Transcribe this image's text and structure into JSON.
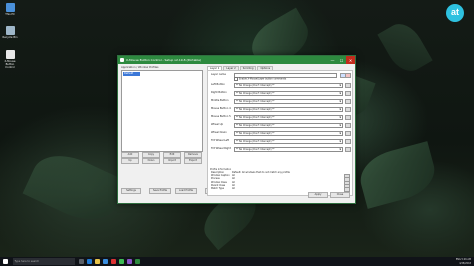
{
  "desktop": {
    "icons": [
      {
        "label": "This PC",
        "name": "this-pc-icon",
        "color": "#4a90d9"
      },
      {
        "label": "Recycle Bin",
        "name": "recycle-bin-icon",
        "color": "#9fb7c9"
      },
      {
        "label": "X-Mouse Button Control",
        "name": "xmouse-shortcut-icon",
        "color": "#e8e8e8"
      }
    ],
    "badge": "at"
  },
  "window": {
    "title": "X-Mouse Button Control - Setup v2.19.8 (Portable)",
    "buttons": {
      "minimize": "—",
      "maximize": "☐",
      "close": "✕"
    },
    "left_pane": {
      "label": "Application / Window Profiles",
      "selected_item": "Default",
      "buttons": [
        "Add",
        "Copy",
        "Edit",
        "Remove",
        "Up",
        "Down",
        "Import",
        "Export"
      ],
      "bottom_buttons": [
        "Settings",
        "Save Profile",
        "Load Profile",
        "Profile"
      ]
    },
    "tabs": [
      "Layer 1",
      "Layer 2",
      "Scrolling",
      "Options"
    ],
    "layer": {
      "layer_name_label": "Layer name",
      "layer_name_value": "",
      "checkbox_label": "Enable X-Mouse/Layer button commands",
      "rows": [
        {
          "label": "Left Button",
          "value": "** No Change (Don't Intercept) **"
        },
        {
          "label": "Right Button",
          "value": "** No Change (Don't Intercept) **"
        },
        {
          "label": "Middle Button",
          "value": "** No Change (Don't Intercept) **"
        },
        {
          "label": "Mouse Button 4",
          "value": "** No Change (Don't Intercept) **"
        },
        {
          "label": "Mouse Button 5",
          "value": "** No Change (Don't Intercept) **"
        },
        {
          "label": "Wheel Up",
          "value": "** No Change (Don't Intercept) **"
        },
        {
          "label": "Wheel Down",
          "value": "** No Change (Don't Intercept) **"
        },
        {
          "label": "Tilt Wheel Left",
          "value": "** No Change (Don't Intercept) **"
        },
        {
          "label": "Tilt Wheel Right",
          "value": "** No Change (Don't Intercept) **"
        }
      ]
    },
    "profile_info": {
      "heading": "Profile Information",
      "rows": [
        {
          "key": "Description",
          "value": "Default: All windows that do not match any profile"
        },
        {
          "key": "Window Caption",
          "value": "All"
        },
        {
          "key": "Process",
          "value": "All"
        },
        {
          "key": "Window Class",
          "value": "All"
        },
        {
          "key": "Parent Class",
          "value": "All"
        },
        {
          "key": "Match Type",
          "value": "All"
        }
      ]
    },
    "footer_buttons": [
      "Apply",
      "Close"
    ]
  },
  "taskbar": {
    "search_placeholder": "Type here to search",
    "time": "5:26 AM",
    "date": "4/28/2018",
    "lang": "ENG"
  }
}
